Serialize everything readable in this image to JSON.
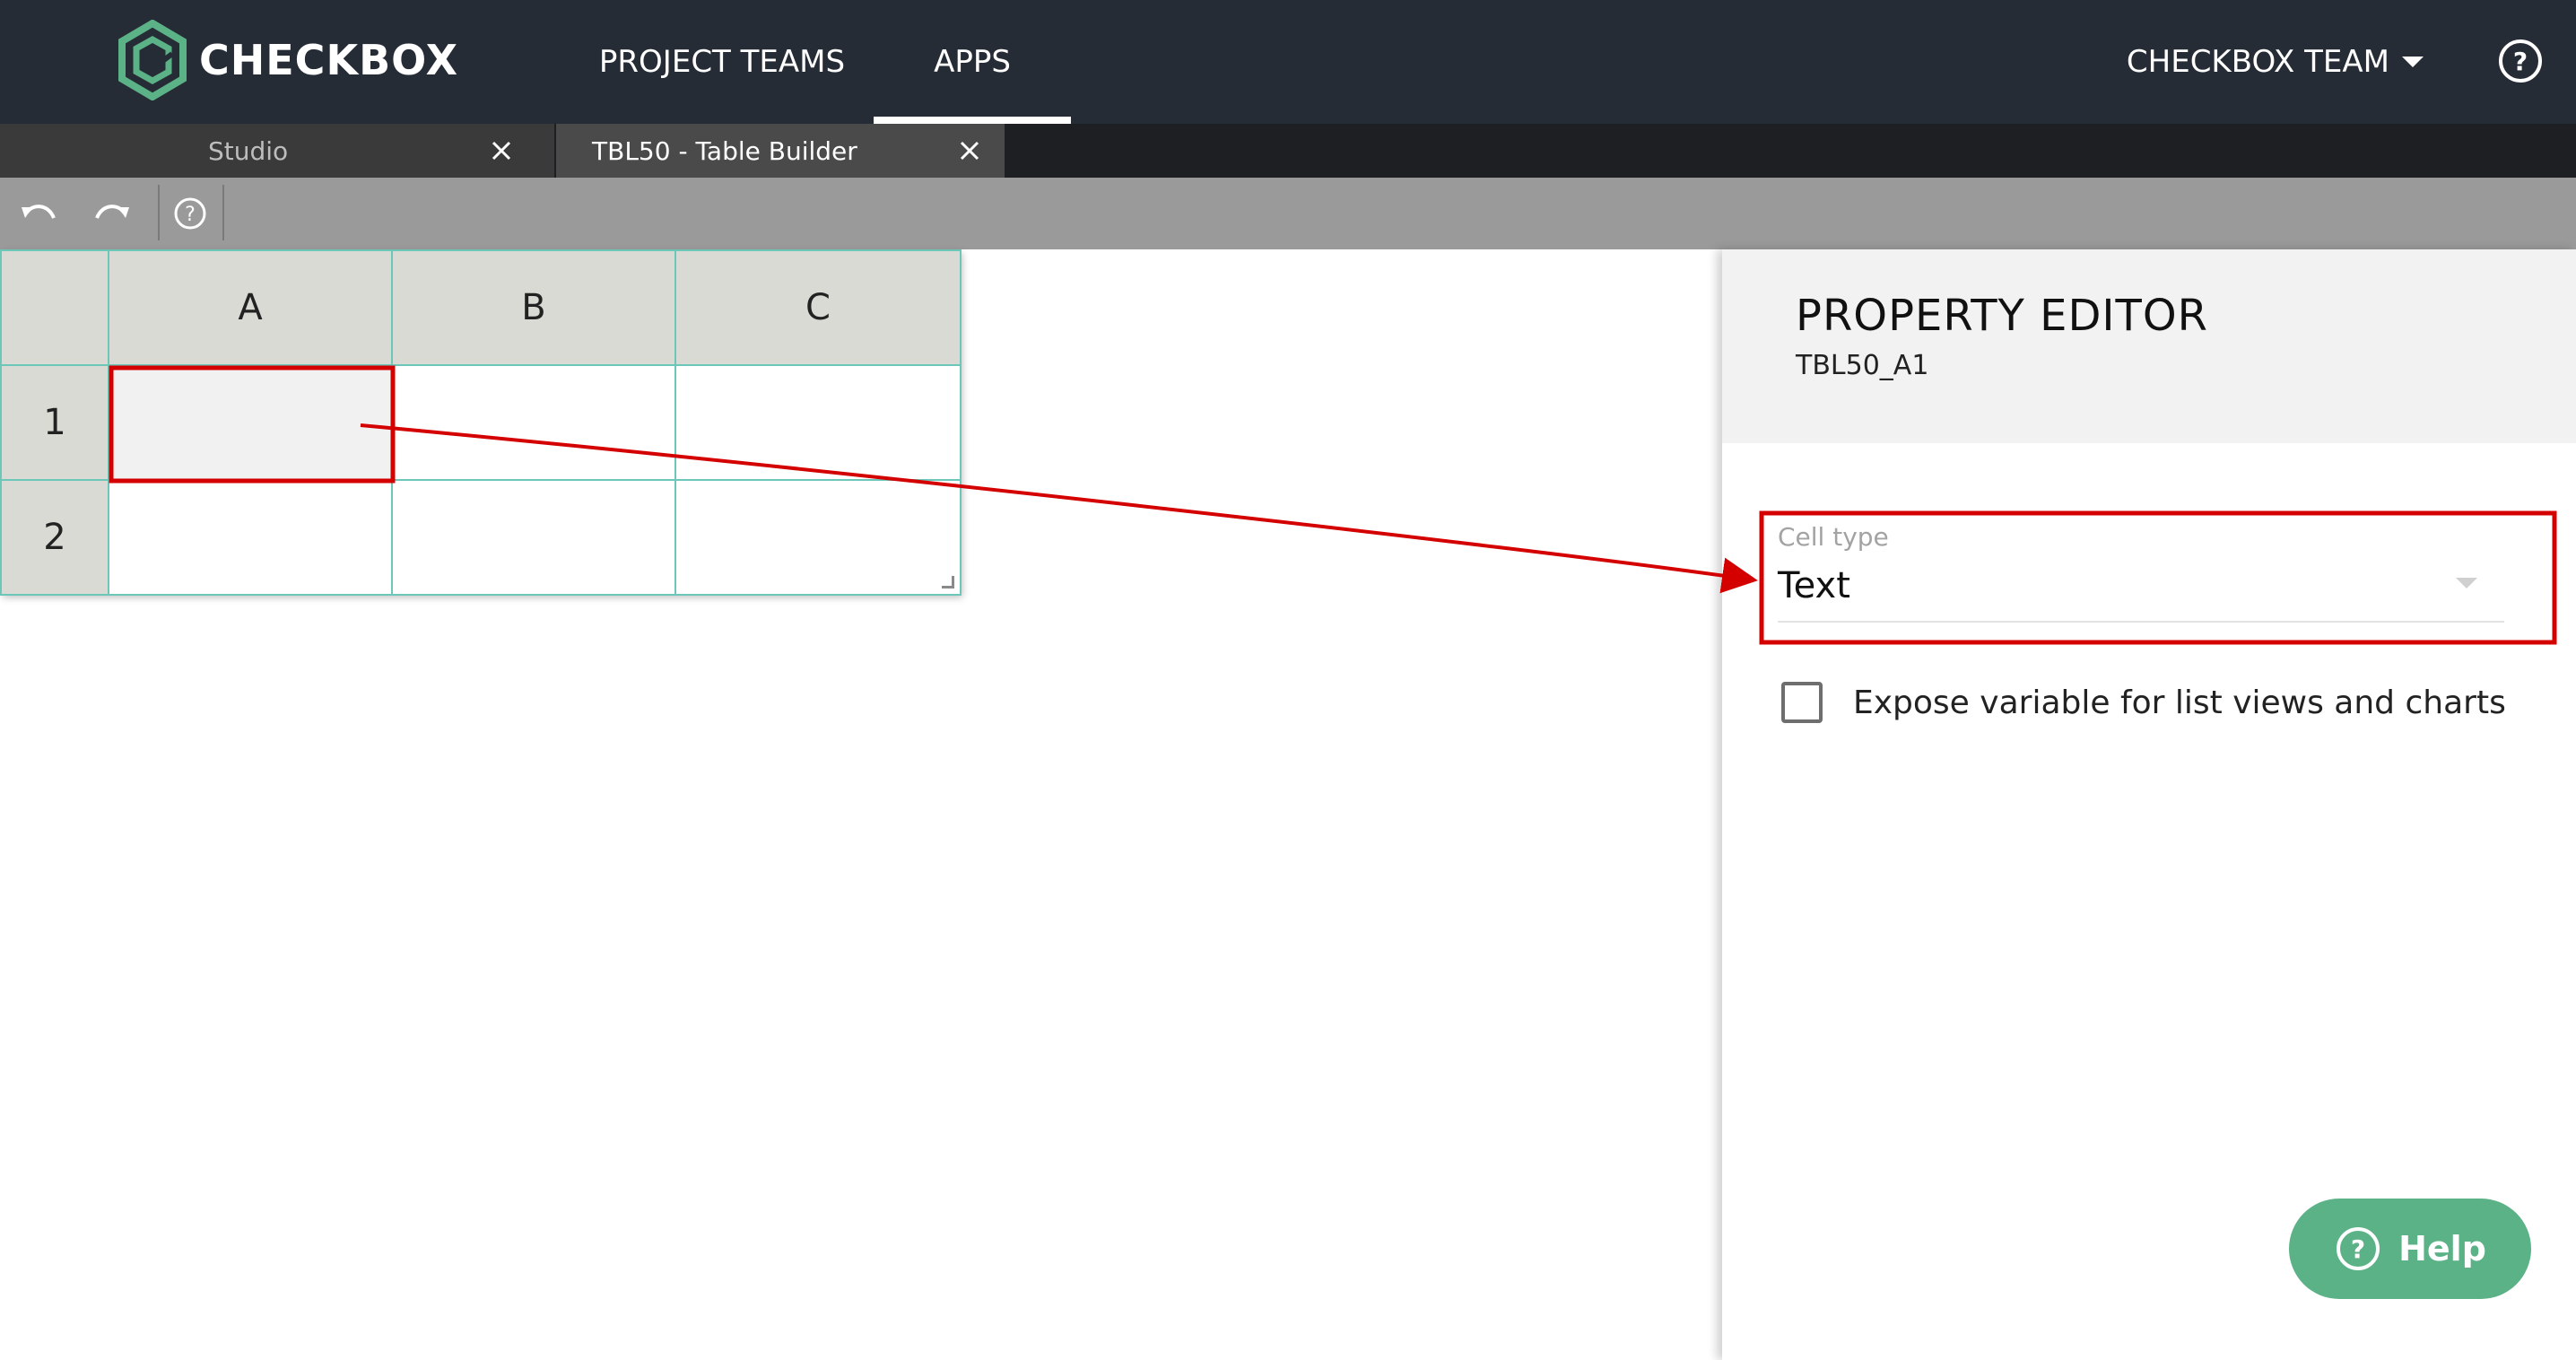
{
  "brand": {
    "name": "CHECKBOX",
    "logo_color": "#5cb287"
  },
  "nav": {
    "items": [
      {
        "label": "PROJECT TEAMS"
      },
      {
        "label": "APPS",
        "active": true
      }
    ],
    "team_label": "CHECKBOX TEAM",
    "help_icon": "question-circle-icon"
  },
  "tabs": [
    {
      "label": "Studio"
    },
    {
      "label": "TBL50 - Table Builder",
      "active": true
    }
  ],
  "toolbar": {
    "undo_icon": "undo-icon",
    "redo_icon": "redo-icon",
    "help_icon": "question-circle-icon"
  },
  "grid": {
    "columns": [
      "A",
      "B",
      "C"
    ],
    "rows": [
      "1",
      "2"
    ],
    "selected_cell": "A1"
  },
  "property_editor": {
    "title": "PROPERTY EDITOR",
    "subtitle": "TBL50_A1",
    "cell_type": {
      "label": "Cell type",
      "value": "Text"
    },
    "expose_variable": {
      "label": "Expose variable for list views and charts",
      "checked": false
    }
  },
  "help_button": {
    "label": "Help"
  },
  "colors": {
    "topnav": "#262c36",
    "accent_green": "#5cb287",
    "grid_border": "#6cc7b8",
    "annotation_red": "#d40000"
  }
}
